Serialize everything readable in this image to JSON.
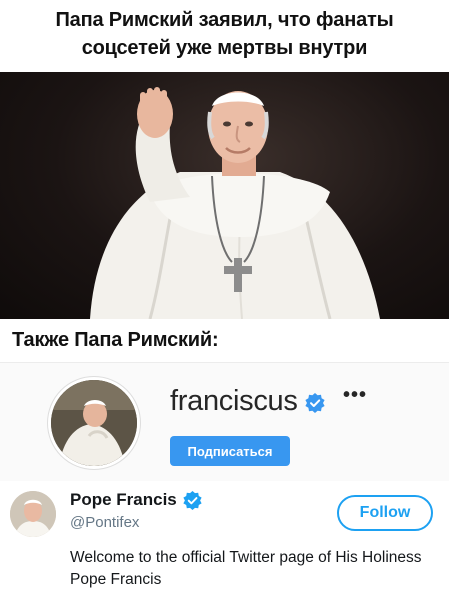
{
  "caption_top": {
    "line1": "Папа Римский заявил, что фанаты",
    "line2": "соцсетей уже мертвы внутри"
  },
  "caption_mid": {
    "text": "Также Папа Римский:"
  },
  "instagram": {
    "username": "franciscus",
    "more_label": "•••",
    "follow_label": "Подписаться",
    "colors": {
      "follow_bg": "#3897f0",
      "verified": "#3897f0"
    }
  },
  "twitter": {
    "name": "Pope Francis",
    "handle": "@Pontifex",
    "follow_label": "Follow",
    "bio": "Welcome to the official Twitter page of His Holiness Pope Francis",
    "colors": {
      "accent": "#1da1f2"
    }
  }
}
